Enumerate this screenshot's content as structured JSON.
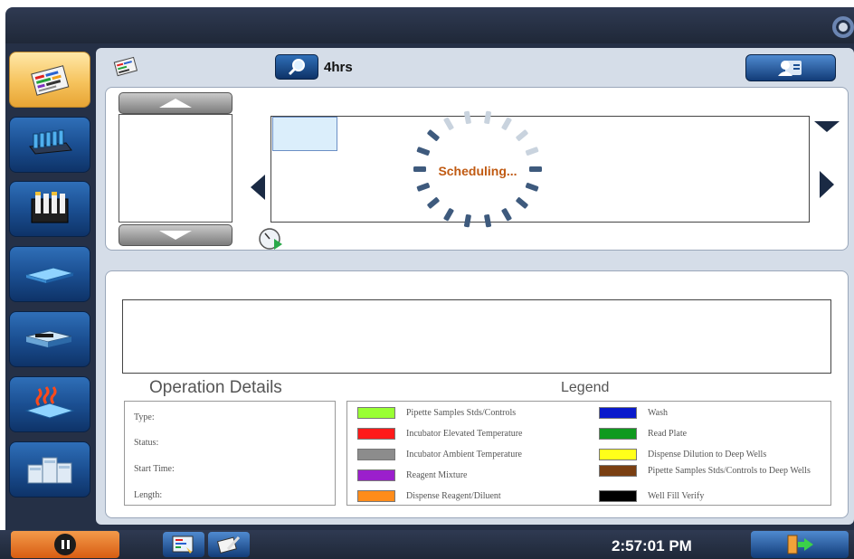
{
  "header": {
    "time_range": "4hrs"
  },
  "sidebar": {
    "items": [
      {
        "icon": "schedule-icon",
        "active": true
      },
      {
        "icon": "sample-rack-icon",
        "active": false
      },
      {
        "icon": "reagent-rack-icon",
        "active": false
      },
      {
        "icon": "microplate-icon",
        "active": false
      },
      {
        "icon": "washer-icon",
        "active": false
      },
      {
        "icon": "incubator-heat-icon",
        "active": false
      },
      {
        "icon": "system-modules-icon",
        "active": false
      }
    ]
  },
  "schedule": {
    "status_text": "Scheduling..."
  },
  "operation_details": {
    "title": "Operation Details",
    "fields": {
      "type": "Type:",
      "status": "Status:",
      "start_time": "Start Time:",
      "length": "Length:"
    }
  },
  "legend": {
    "title": "Legend",
    "items": [
      {
        "label": "Pipette Samples Stds/Controls",
        "color": "#99ff33"
      },
      {
        "label": "Incubator Elevated Temperature",
        "color": "#ff1a1a"
      },
      {
        "label": "Incubator Ambient Temperature",
        "color": "#8c8c8c"
      },
      {
        "label": "Reagent Mixture",
        "color": "#9b1fcc"
      },
      {
        "label": "Dispense Reagent/Diluent",
        "color": "#ff8c1a"
      },
      {
        "label": "Wash",
        "color": "#0a1acc"
      },
      {
        "label": "Read Plate",
        "color": "#0f9a1f"
      },
      {
        "label": "Dispense Dilution to Deep Wells",
        "color": "#ffff1a"
      },
      {
        "label": "Pipette Samples Stds/Controls to Deep Wells",
        "color": "#7a3f12"
      },
      {
        "label": "Well Fill Verify",
        "color": "#000000"
      }
    ]
  },
  "footer": {
    "clock": "2:57:01 PM"
  },
  "colors": {
    "accent_orange": "#e8752a",
    "nav_blue": "#1b4f92",
    "frame_dark": "#253046"
  }
}
